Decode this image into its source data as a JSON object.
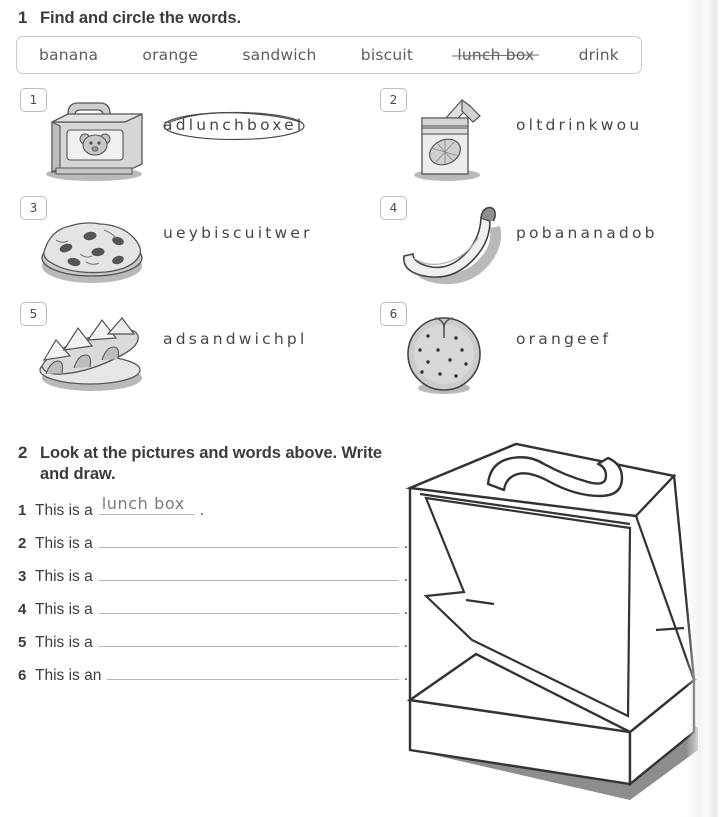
{
  "exercise1": {
    "number": "1",
    "title": "Find and circle the words.",
    "word_bank": [
      {
        "word": "banana",
        "struck": false
      },
      {
        "word": "orange",
        "struck": false
      },
      {
        "word": "sandwich",
        "struck": false
      },
      {
        "word": "biscuit",
        "struck": false
      },
      {
        "word": "lunch box",
        "struck": true
      },
      {
        "word": "drink",
        "struck": false
      }
    ],
    "items": [
      {
        "number": "1",
        "picture": "lunch-box-picture",
        "letters": "adlunchboxel",
        "circled": "lunchbox"
      },
      {
        "number": "2",
        "picture": "drink-carton-picture",
        "letters": "oltdrinkwou",
        "circled": ""
      },
      {
        "number": "3",
        "picture": "biscuit-picture",
        "letters": "ueybiscuitwer",
        "circled": ""
      },
      {
        "number": "4",
        "picture": "banana-picture",
        "letters": "pobananadob",
        "circled": ""
      },
      {
        "number": "5",
        "picture": "sandwich-picture",
        "letters": "adsandwichpl",
        "circled": ""
      },
      {
        "number": "6",
        "picture": "orange-picture",
        "letters": "orangeef",
        "circled": ""
      }
    ]
  },
  "exercise2": {
    "number": "2",
    "title": "Look at the pictures and words above. Write and draw.",
    "sentences": [
      {
        "number": "1",
        "stem": "This is a",
        "answer": "lunch box",
        "end": "."
      },
      {
        "number": "2",
        "stem": "This is a",
        "answer": "",
        "end": "."
      },
      {
        "number": "3",
        "stem": "This is a",
        "answer": "",
        "end": "."
      },
      {
        "number": "4",
        "stem": "This is a",
        "answer": "",
        "end": "."
      },
      {
        "number": "5",
        "stem": "This is a",
        "answer": "",
        "end": "."
      },
      {
        "number": "6",
        "stem": "This is an",
        "answer": "",
        "end": "."
      }
    ],
    "drawing": "open-lunch-box-outline"
  },
  "colors": {
    "text": "#3c3c3c",
    "muted": "#5d5d5d",
    "rule": "#b6b6b6",
    "border": "#c9c9c9",
    "answer": "#7b7b7b"
  }
}
